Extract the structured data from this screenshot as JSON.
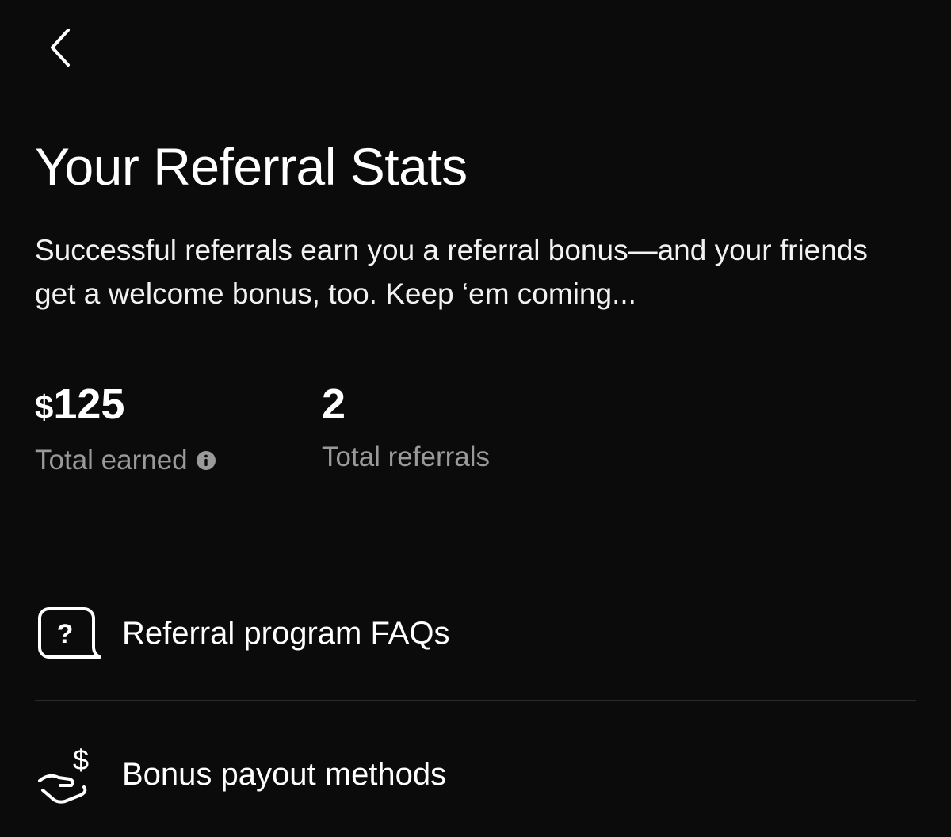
{
  "nav": {
    "back_icon": "chevron-left-icon"
  },
  "header": {
    "title": "Your Referral Stats",
    "description": "Successful referrals earn you a referral bonus—and your friends get a welcome bonus, too. Keep ‘em coming..."
  },
  "stats": {
    "earned": {
      "currency": "$",
      "amount": "125",
      "label": "Total earned",
      "info_icon": "info-icon"
    },
    "referrals": {
      "value": "2",
      "label": "Total referrals"
    }
  },
  "menu": [
    {
      "icon": "question-bubble-icon",
      "label": "Referral program FAQs"
    },
    {
      "icon": "hand-dollar-icon",
      "label": "Bonus payout methods"
    }
  ],
  "colors": {
    "background": "#0b0b0b",
    "text_primary": "#ffffff",
    "text_secondary": "#9a9a9a",
    "divider": "#2a2a2a"
  }
}
